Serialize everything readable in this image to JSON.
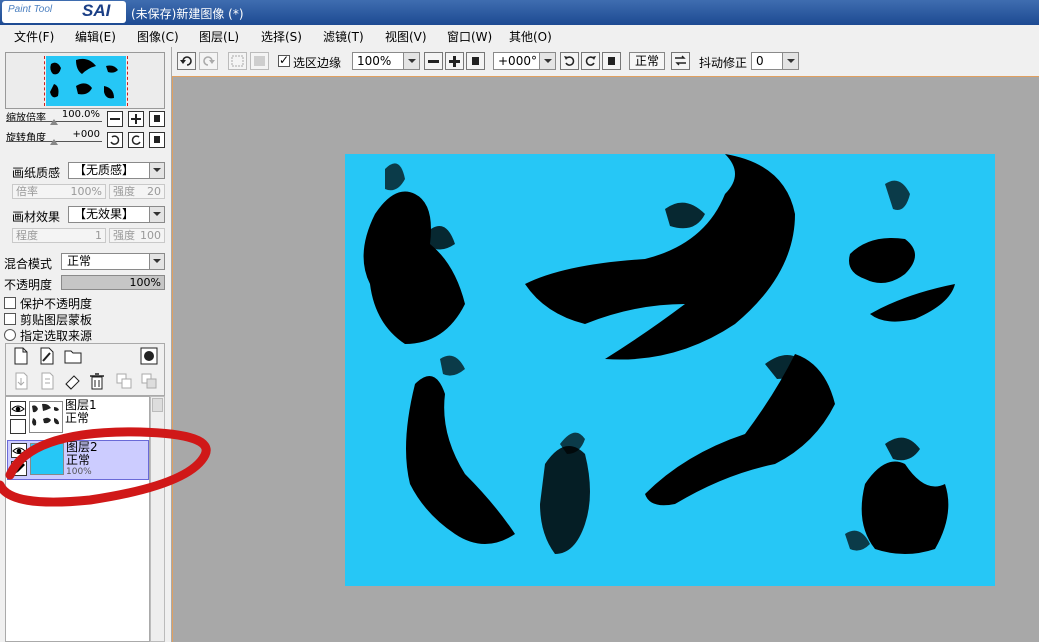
{
  "title_bar": {
    "logo_small": "Paint Tool",
    "logo_big": "SAI",
    "document_title": "(未保存)新建图像 (*)"
  },
  "menu": [
    "文件(F)",
    "编辑(E)",
    "图像(C)",
    "图层(L)",
    "选择(S)",
    "滤镜(T)",
    "视图(V)",
    "窗口(W)",
    "其他(O)"
  ],
  "toolbar": {
    "selection_edge_label": "选区边缘",
    "selection_edge_checked": true,
    "zoom_value": "100%",
    "rotation_value": "+000°",
    "mode_button": "正常",
    "stabilizer_label": "抖动修正",
    "stabilizer_value": "0"
  },
  "navigator": {
    "zoom_label": "缩放倍率",
    "zoom_value": "100.0%",
    "rotate_label": "旋转角度",
    "rotate_value": "+000"
  },
  "brush_settings": {
    "paper_texture_label": "画纸质感",
    "paper_texture_value": "【无质感】",
    "scale_label": "倍率",
    "scale_value": "100%",
    "strength_label": "强度",
    "strength_value": "20",
    "material_effect_label": "画材效果",
    "material_effect_value": "【无效果】",
    "degree_label": "程度",
    "degree_value": "1",
    "strength2_label": "强度",
    "strength2_value": "100"
  },
  "layer_settings": {
    "blend_mode_label": "混合模式",
    "blend_mode_value": "正常",
    "opacity_label": "不透明度",
    "opacity_value": "100%",
    "preserve_opacity": "保护不透明度",
    "clipping_group": "剪贴图层蒙板",
    "selection_source": "指定选取来源"
  },
  "layers": [
    {
      "name": "图层1",
      "mode": "正常",
      "opacity": "",
      "selected": false,
      "thumb": "ink"
    },
    {
      "name": "图层2",
      "mode": "正常",
      "opacity": "100%",
      "selected": true,
      "thumb": "cyan"
    }
  ],
  "colors": {
    "canvas_fill": "#26c7f6",
    "ink": "#000000",
    "workspace": "#a8a8a8",
    "annotation": "#d01818",
    "selected_layer": "#ccccff"
  }
}
